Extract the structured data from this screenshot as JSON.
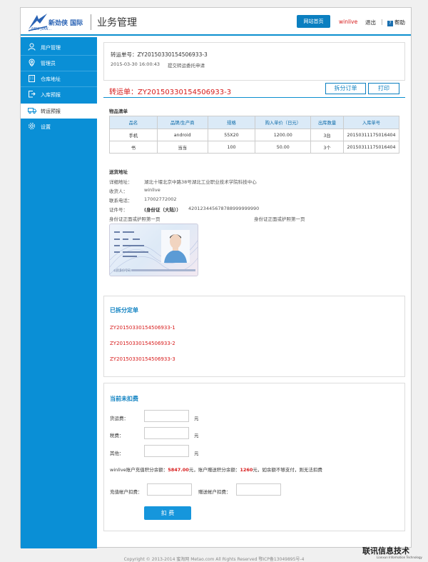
{
  "header": {
    "logo_text": "新劲侠 国际",
    "logo_sub": "NEW JIAN...",
    "app_title": "业务管理",
    "home_button": "网站首页",
    "user_name": "winlive",
    "logout": "退出",
    "separator": "|",
    "help": "帮助"
  },
  "sidebar": {
    "items": [
      {
        "label": "用户管理",
        "icon": "user-icon"
      },
      {
        "label": "管理员",
        "icon": "location-pin-icon"
      },
      {
        "label": "仓库地址",
        "icon": "building-icon"
      },
      {
        "label": "入库预报",
        "icon": "document-export-icon"
      },
      {
        "label": "转运预报",
        "icon": "truck-icon"
      },
      {
        "label": "设置",
        "icon": "gear-icon"
      }
    ],
    "active_index": 4
  },
  "summary": {
    "label": "转运单号：ZY20150330154506933-3",
    "datetime": "2015-03-30 16:00:43",
    "action": "提交转运委托申请"
  },
  "order": {
    "prefix": "转运单：",
    "number": "ZY20150330154506933-3",
    "split_button": "拆分订单",
    "print_button": "打印"
  },
  "goods": {
    "title": "物品清单",
    "columns": [
      "品名",
      "品牌/生产商",
      "规格",
      "购入单价（日元）",
      "出库数量",
      "入库单号"
    ],
    "rows": [
      [
        "手机",
        "android",
        "55X20",
        "1200.00",
        "3台",
        "20150311175016404"
      ],
      [
        "书",
        "当当",
        "100",
        "50.00",
        "3个",
        "20150311175016404"
      ]
    ]
  },
  "address": {
    "title": "送货地址",
    "detail_label": "详细地址：",
    "detail_value": "湖北十堰北京中路38号湖北工业职业技术学院科技中心",
    "receiver_label": "收货人：",
    "receiver_value": "winlive",
    "phone_label": "联系电话：",
    "phone_value": "17002772002",
    "id_label": "证件号：",
    "id_type": "(身份证（大陆））",
    "id_value": "420123445678788999999990",
    "id_front_label": "身份证正面或护照第一页",
    "id_back_label": "身份证正面或护照第一页",
    "id_card_footer": "公民身份号码"
  },
  "split_orders": {
    "title": "已拆分定单",
    "items": [
      "ZY20150330154506933-1",
      "ZY20150330154506933-2",
      "ZY20150330154506933-3"
    ]
  },
  "fees": {
    "title": "当前未扣费",
    "freight_label": "货运费：",
    "tax_label": "税费：",
    "other_label": "其他：",
    "unit": "元",
    "balance_user": "winlive",
    "balance_text1": "账户充值积分余额：",
    "recharge_balance": "5847.00",
    "balance_text2": "元，账户赠送积分余额：",
    "gift_balance": "1260",
    "balance_text3": "元，如余额不够支付，则无法扣费",
    "recharge_deduct_label": "充值帐户扣费：",
    "gift_deduct_label": "赠送帐户扣费：",
    "deduct_button": "扣 费"
  },
  "footer": {
    "text": "Copyright © 2013-2014 蜜淘网 Metao.com All Rights Reserved  鄂ICP备13049895号-4"
  },
  "watermark": {
    "text": "联讯信息技术",
    "sub": "Lianxun Information Technology"
  }
}
